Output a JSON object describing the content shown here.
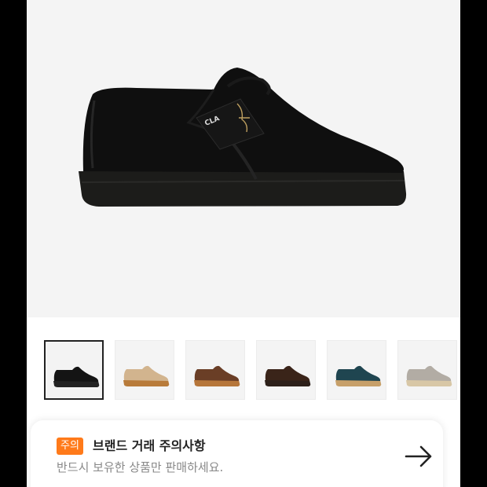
{
  "product": {
    "main_image": {
      "icon": "shoe-black-image",
      "color": "#0e0e0e"
    }
  },
  "thumbnails": [
    {
      "icon": "shoe-black-thumbnail",
      "color": "#141414",
      "selected": true
    },
    {
      "icon": "shoe-sand-thumbnail",
      "color": "#c9a981",
      "selected": false
    },
    {
      "icon": "shoe-brown-thumbnail",
      "color": "#6a3e26",
      "selected": false
    },
    {
      "icon": "shoe-darkbrown-thumbnail",
      "color": "#3a2419",
      "selected": false
    },
    {
      "icon": "shoe-teal-thumbnail",
      "color": "#1f4550",
      "selected": false
    },
    {
      "icon": "shoe-grey-thumbnail",
      "color": "#b2aca4",
      "selected": false
    }
  ],
  "notice": {
    "badge": "주의",
    "title": "브랜드 거래 주의사항",
    "subtitle": "반드시 보유한 상품만 판매하세요.",
    "arrow_icon": "arrow-right-icon",
    "badge_color": "#ff7a1a"
  }
}
